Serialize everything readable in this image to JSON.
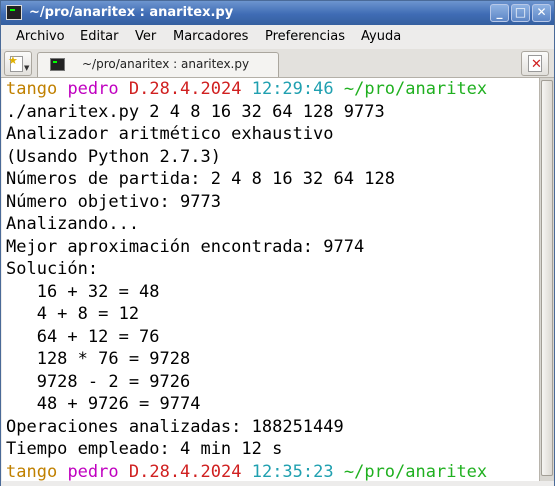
{
  "window": {
    "title": "~/pro/anaritex : anaritex.py",
    "buttons": {
      "minimize": "_",
      "maximize": "□",
      "close": "✕"
    }
  },
  "menubar": {
    "items": [
      "Archivo",
      "Editar",
      "Ver",
      "Marcadores",
      "Preferencias",
      "Ayuda"
    ]
  },
  "tabs": {
    "active_label": "~/pro/anaritex : anaritex.py"
  },
  "colors": {
    "user": "#c08000",
    "host": "#c000c0",
    "date": "#d02020",
    "time": "#20a0b0",
    "path": "#20b020"
  },
  "terminal": {
    "prompt1": {
      "user": "tango",
      "host": "pedro",
      "date": "D.28.4.2024",
      "time": "12:29:46",
      "path": "~/pro/anaritex"
    },
    "output": [
      "./anaritex.py 2 4 8 16 32 64 128 9773",
      "Analizador aritmético exhaustivo",
      "(Usando Python 2.7.3)",
      "Números de partida: 2 4 8 16 32 64 128",
      "Número objetivo: 9773",
      "Analizando...",
      "Mejor aproximación encontrada: 9774",
      "Solución:",
      "   16 + 32 = 48",
      "   4 + 8 = 12",
      "   64 + 12 = 76",
      "   128 * 76 = 9728",
      "   9728 - 2 = 9726",
      "   48 + 9726 = 9774",
      "Operaciones analizadas: 188251449",
      "Tiempo empleado: 4 min 12 s"
    ],
    "prompt2": {
      "user": "tango",
      "host": "pedro",
      "date": "D.28.4.2024",
      "time": "12:35:23",
      "path": "~/pro/anaritex"
    }
  }
}
